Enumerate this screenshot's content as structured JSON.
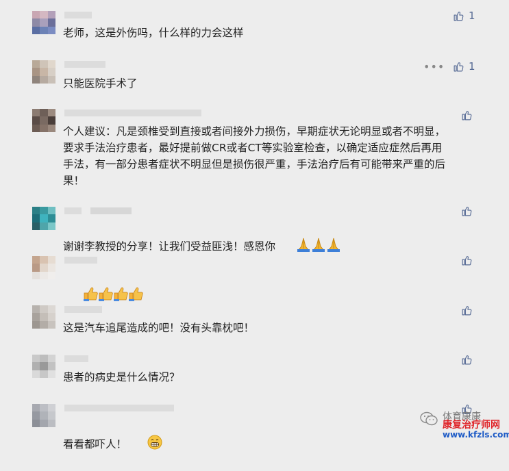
{
  "comments": [
    {
      "text": "老师，这是外伤吗，什么样的力会这样",
      "likes": "1",
      "has_more": false
    },
    {
      "text": "只能医院手术了",
      "likes": "1",
      "has_more": true,
      "more_label": "•••"
    },
    {
      "text": "个人建议：凡是颈椎受到直接或者间接外力损伤，早期症状无论明显或者不明显，\n要求手法治疗患者，最好提前做CR或者CT等实验室检查，以确定适应症然后再用\n手法，有一部分患者症状不明显但是损伤很严重，手法治疗后有可能带来严重的后\n果！",
      "likes": "",
      "has_more": false
    },
    {
      "text": "谢谢李教授的分享！让我们受益匪浅！感恩你",
      "likes": "",
      "emoji": "pray-icon",
      "emoji_count": 3
    },
    {
      "text": "",
      "likes": "",
      "emoji": "thumbs-up-icon",
      "emoji_count": 4
    },
    {
      "text": "这是汽车追尾造成的吧！没有头靠枕吧！",
      "likes": ""
    },
    {
      "text": "患者的病史是什么情况？",
      "likes": ""
    },
    {
      "text": "看看都吓人！",
      "likes": "",
      "emoji": "grimace-icon",
      "emoji_count": 1
    }
  ],
  "watermark": {
    "account": "体育康康",
    "site_name": "康复治疗师网",
    "site_url": "www.kfzls.com"
  },
  "colors": {
    "background": "#ededed",
    "like_blue": "#576b95",
    "text": "#222222"
  }
}
